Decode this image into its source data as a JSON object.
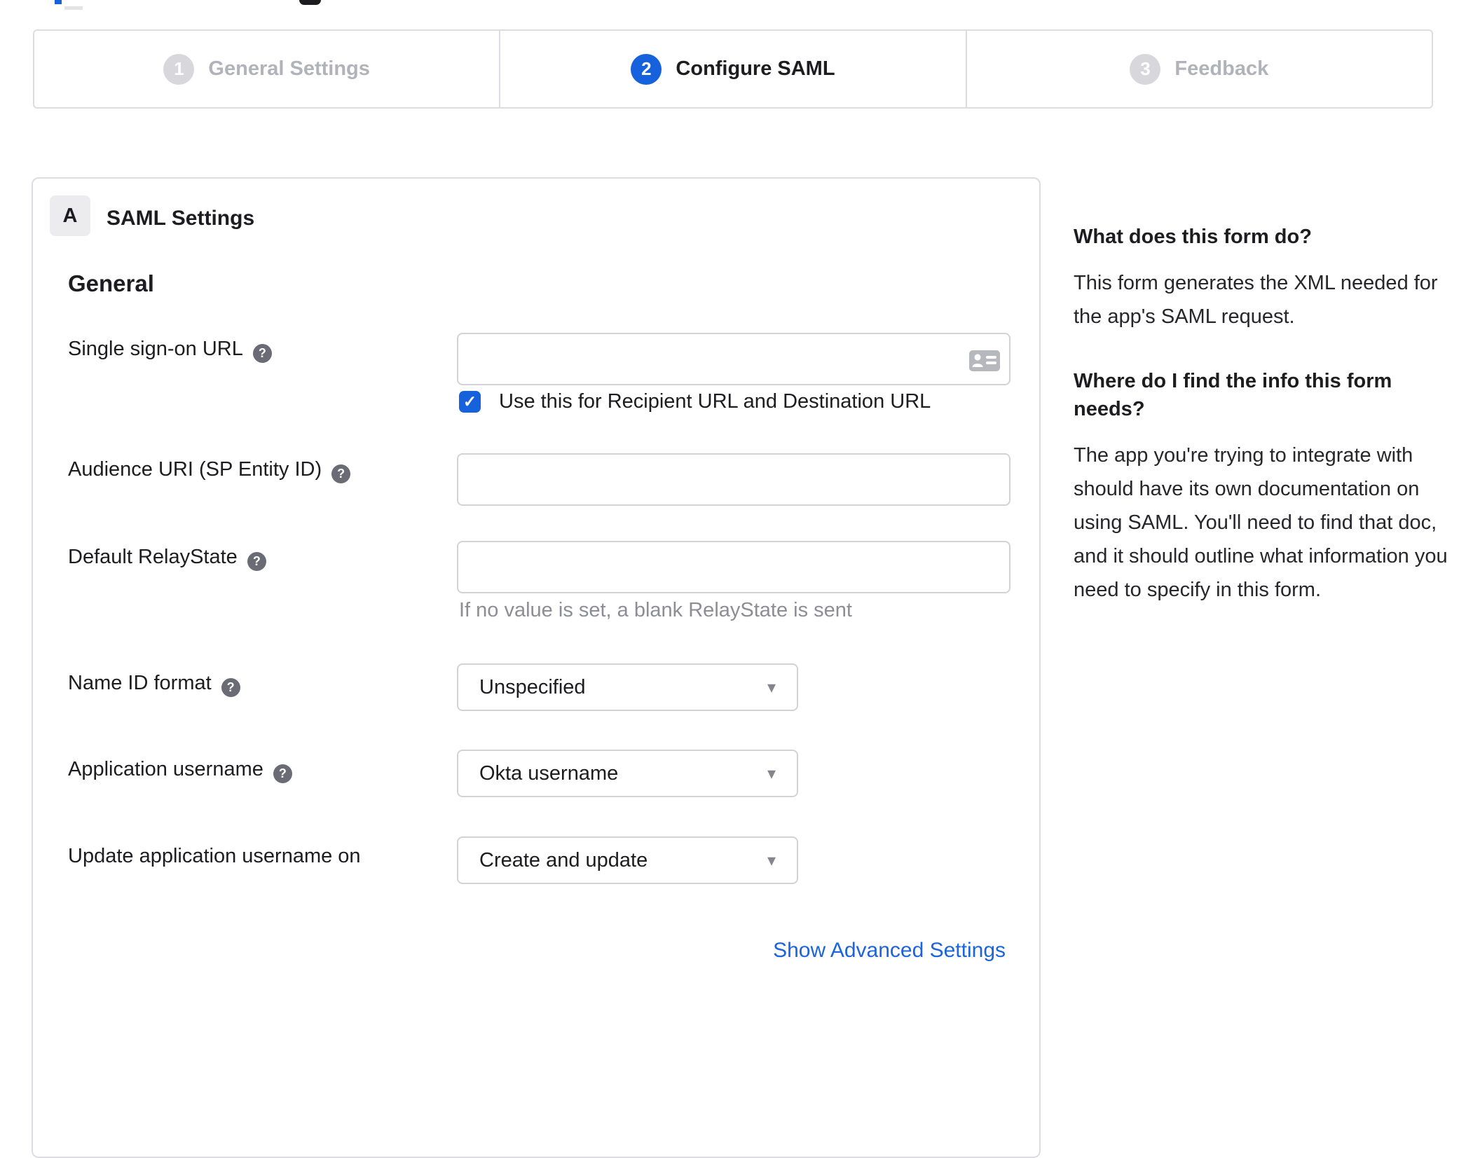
{
  "colors": {
    "accent_blue": "#1662dd",
    "inactive_gray": "#d8d8dc",
    "border_gray": "#dcdce2",
    "hint_gray": "#8d8d95",
    "link_blue": "#1b64dd"
  },
  "icons": {
    "help": "?",
    "checkbox_check": "✓",
    "dropdown_arrow": "▾",
    "contact_card": "contact-card-autofill"
  },
  "stepper": {
    "steps": [
      {
        "number": "1",
        "label": "General Settings",
        "state": "inactive"
      },
      {
        "number": "2",
        "label": "Configure SAML",
        "state": "active"
      },
      {
        "number": "3",
        "label": "Feedback",
        "state": "inactive"
      }
    ]
  },
  "panel": {
    "section_badge": "A",
    "section_title": "SAML Settings",
    "group_heading": "General",
    "fields": [
      {
        "type": "text",
        "label": "Single sign-on URL",
        "has_help": true,
        "value": "",
        "trailing_icon": "contact-card",
        "checkbox": {
          "checked": true,
          "label": "Use this for Recipient URL and Destination URL"
        }
      },
      {
        "type": "text",
        "label": "Audience URI (SP Entity ID)",
        "has_help": true,
        "value": ""
      },
      {
        "type": "text",
        "label": "Default RelayState",
        "has_help": true,
        "value": "",
        "hint": "If no value is set, a blank RelayState is sent"
      },
      {
        "type": "select",
        "label": "Name ID format",
        "has_help": true,
        "value": "Unspecified"
      },
      {
        "type": "select",
        "label": "Application username",
        "has_help": true,
        "value": "Okta username"
      },
      {
        "type": "select",
        "label": "Update application username on",
        "has_help": false,
        "value": "Create and update"
      }
    ],
    "advanced_link": "Show Advanced Settings"
  },
  "sidebar": {
    "blocks": [
      {
        "heading": "What does this form do?",
        "body": "This form generates the XML needed for the app's SAML request."
      },
      {
        "heading": "Where do I find the info this form needs?",
        "body": "The app you're trying to integrate with should have its own documentation on using SAML. You'll need to find that doc, and it should outline what information you need to specify in this form."
      }
    ]
  }
}
